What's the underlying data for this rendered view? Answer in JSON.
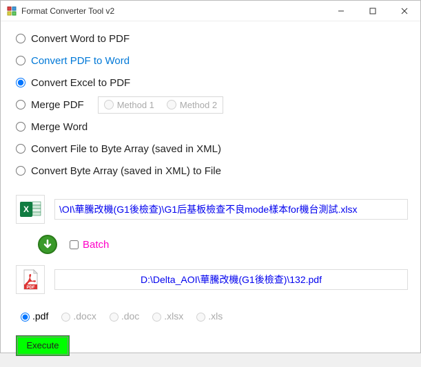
{
  "window": {
    "title": "Format Converter Tool v2"
  },
  "options": {
    "word_to_pdf": "Convert Word to PDF",
    "pdf_to_word": "Convert PDF to Word",
    "excel_to_pdf": "Convert Excel to PDF",
    "merge_pdf": "Merge PDF",
    "merge_word": "Merge Word",
    "file_to_byte": "Convert File to Byte Array (saved in XML)",
    "byte_to_file": "Convert Byte Array (saved in XML) to File",
    "selected": "excel_to_pdf"
  },
  "methods": {
    "method1": "Method 1",
    "method2": "Method 2"
  },
  "paths": {
    "input": "\\OI\\華騰改機(G1後檢查)\\G1后基板檢查不良mode樣本for機台測試.xlsx",
    "output": "D:\\Delta_AOI\\華騰改機(G1後檢查)\\132.pdf"
  },
  "batch": {
    "label": "Batch",
    "checked": false
  },
  "extensions": {
    "pdf": ".pdf",
    "docx": ".docx",
    "doc": ".doc",
    "xlsx": ".xlsx",
    "xls": ".xls",
    "selected": "pdf"
  },
  "buttons": {
    "execute": "Execute"
  }
}
